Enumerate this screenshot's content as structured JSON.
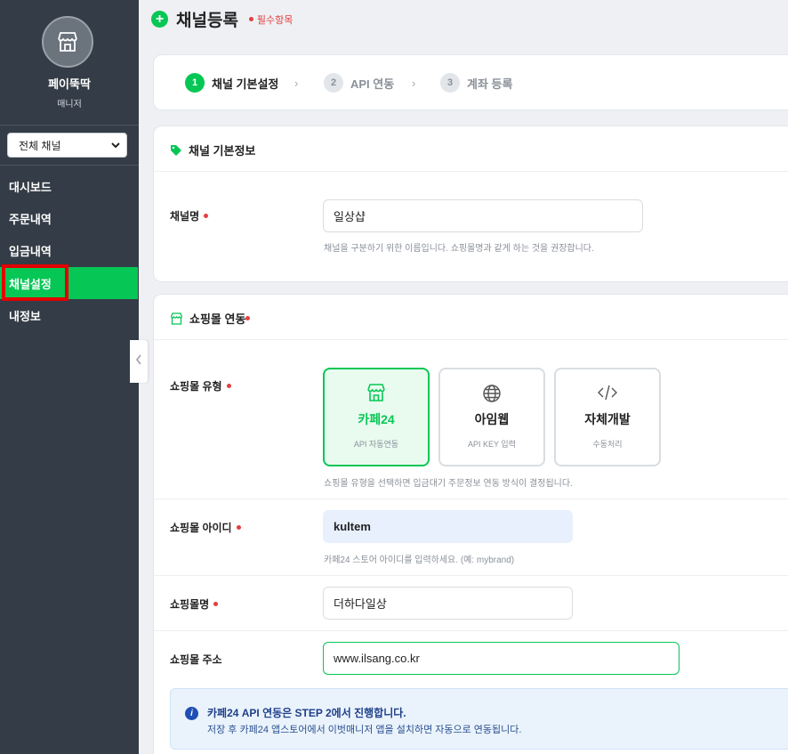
{
  "sidebar": {
    "brand": "페이뚝딱",
    "brand_sub": "매니저",
    "channel_select": "전체 채널",
    "nav": [
      {
        "label": "대시보드"
      },
      {
        "label": "주문내역"
      },
      {
        "label": "입금내역"
      },
      {
        "label": "채널설정"
      },
      {
        "label": "내정보"
      }
    ]
  },
  "header": {
    "title": "채널등록",
    "required_note": "필수항목"
  },
  "steps": [
    {
      "num": "1",
      "label": "채널 기본설정"
    },
    {
      "num": "2",
      "label": "API 연동"
    },
    {
      "num": "3",
      "label": "계좌 등록"
    }
  ],
  "basic": {
    "title": "채널 기본정보",
    "channel_name_label": "채널명",
    "channel_name_value": "일상샵",
    "channel_name_help": "채널을 구분하기 위한 이름입니다. 쇼핑몰명과 같게 하는 것을 권장합니다."
  },
  "mall": {
    "title": "쇼핑몰 연동",
    "type_label": "쇼핑몰 유형",
    "options": [
      {
        "name": "카페24",
        "desc": "API 자동연동"
      },
      {
        "name": "아임웹",
        "desc": "API KEY 입력"
      },
      {
        "name": "자체개발",
        "desc": "수동처리"
      }
    ],
    "type_help": "쇼핑몰 유형을 선택하면 입금대기 주문정보 연동 방식이 결정됩니다.",
    "id_label": "쇼핑몰 아이디",
    "id_value": "kultem",
    "id_help": "카페24 스토어 아이디를 입력하세요. (예: mybrand)",
    "name_label": "쇼핑몰명",
    "name_value": "더하다일상",
    "address_label": "쇼핑몰 주소",
    "address_value": "www.ilsang.co.kr",
    "notice_title": "카페24 API 연동은 STEP 2에서 진행합니다.",
    "notice_desc": "저장 후 카페24 앱스토어에서 이벗매니저 앱을 설치하면 자동으로 연동됩니다."
  },
  "colors": {
    "accent": "#06c755",
    "sidebar": "#343c47",
    "required": "#e53e3e",
    "highlight": "#e30000"
  }
}
